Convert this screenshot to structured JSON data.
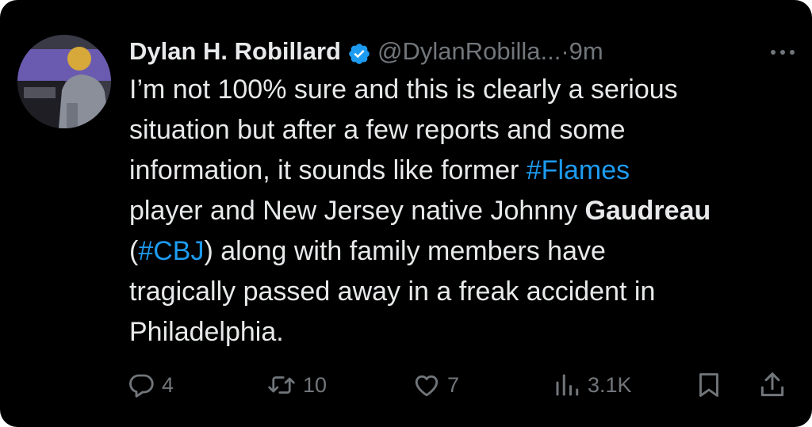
{
  "tweet": {
    "author": {
      "name": "Dylan H. Robillard",
      "handle": "@DylanRobilla...",
      "verified": true,
      "badge_color": "#1d9bf0"
    },
    "separator": "·",
    "time": "9m",
    "more_icon": "more-horizontal-icon",
    "body": {
      "line1": "I’m not 100% sure and this is clearly a serious",
      "line2": "situation but after a few reports and some",
      "line3_prefix": "information, it sounds like former ",
      "line3_hashtag": "#Flames",
      "line4_prefix": "player and New Jersey native Johnny ",
      "line4_bold": "Gaudreau",
      "line5_open": "(",
      "line5_hashtag": "#CBJ",
      "line5_suffix": ") along with family members have",
      "line6": "tragically passed away in a freak accident in",
      "line7": "Philadelphia."
    },
    "hashtag_color": "#1d9bf0",
    "actions": {
      "reply": {
        "icon": "reply-icon",
        "count": "4"
      },
      "retweet": {
        "icon": "retweet-icon",
        "count": "10"
      },
      "like": {
        "icon": "heart-icon",
        "count": "7"
      },
      "views": {
        "icon": "views-icon",
        "count": "3.1K"
      },
      "bookmark": {
        "icon": "bookmark-icon"
      },
      "share": {
        "icon": "share-icon"
      }
    }
  }
}
